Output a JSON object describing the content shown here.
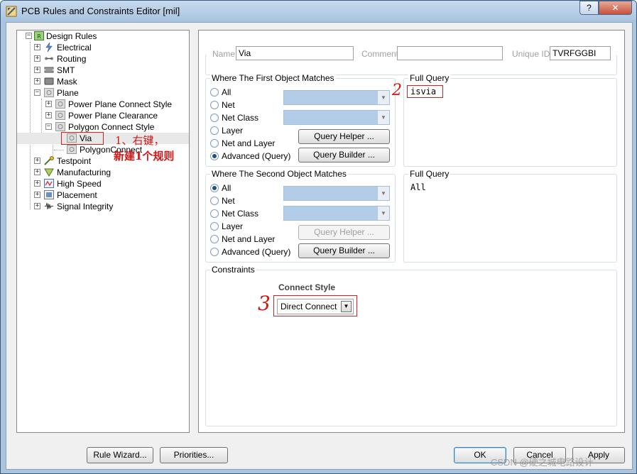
{
  "window": {
    "title": "PCB Rules and Constraints Editor [mil]",
    "help_label": "?",
    "close_label": "✕"
  },
  "tree": {
    "root": "Design Rules",
    "items": [
      {
        "label": "Electrical",
        "icon": "electrical-icon"
      },
      {
        "label": "Routing",
        "icon": "routing-icon"
      },
      {
        "label": "SMT",
        "icon": "smt-icon"
      },
      {
        "label": "Mask",
        "icon": "mask-icon"
      },
      {
        "label": "Plane",
        "icon": "plane-icon"
      },
      {
        "label": "Power Plane Connect Style",
        "icon": "rule-icon"
      },
      {
        "label": "Power Plane Clearance",
        "icon": "rule-icon"
      },
      {
        "label": "Polygon Connect Style",
        "icon": "rule-icon"
      },
      {
        "label": "Via",
        "icon": "rule-icon"
      },
      {
        "label": "PolygonConnect",
        "icon": "rule-icon"
      },
      {
        "label": "Testpoint",
        "icon": "testpoint-icon"
      },
      {
        "label": "Manufacturing",
        "icon": "manufacturing-icon"
      },
      {
        "label": "High Speed",
        "icon": "high-speed-icon"
      },
      {
        "label": "Placement",
        "icon": "placement-icon"
      },
      {
        "label": "Signal Integrity",
        "icon": "signal-integrity-icon"
      }
    ]
  },
  "rule": {
    "name_label": "Name",
    "name_value": "Via",
    "comment_label": "Comment",
    "comment_value": "",
    "unique_id_label": "Unique ID",
    "unique_id_value": "TVRFGGBI"
  },
  "first_match": {
    "title": "Where The First Object Matches",
    "options": [
      "All",
      "Net",
      "Net Class",
      "Layer",
      "Net and Layer",
      "Advanced (Query)"
    ],
    "selected": "Advanced (Query)",
    "query_helper": "Query Helper ...",
    "query_builder": "Query Builder ...",
    "full_query_title": "Full Query",
    "full_query": "isvia"
  },
  "second_match": {
    "title": "Where The Second Object Matches",
    "options": [
      "All",
      "Net",
      "Net Class",
      "Layer",
      "Net and Layer",
      "Advanced (Query)"
    ],
    "selected": "All",
    "query_helper": "Query Helper ...",
    "query_builder": "Query Builder ...",
    "full_query_title": "Full Query",
    "full_query": "All"
  },
  "constraints": {
    "title": "Constraints",
    "connect_style_label": "Connect Style",
    "connect_style_value": "Direct Connect"
  },
  "annotations": {
    "step1_line1": "1、右键，",
    "step1_line2": "新建1个规则",
    "mark2": "2",
    "mark3": "3"
  },
  "buttons": {
    "rule_wizard": "Rule Wizard...",
    "priorities": "Priorities...",
    "ok": "OK",
    "cancel": "Cancel",
    "apply": "Apply"
  },
  "watermark": "CSDN @硬之城电路设计"
}
